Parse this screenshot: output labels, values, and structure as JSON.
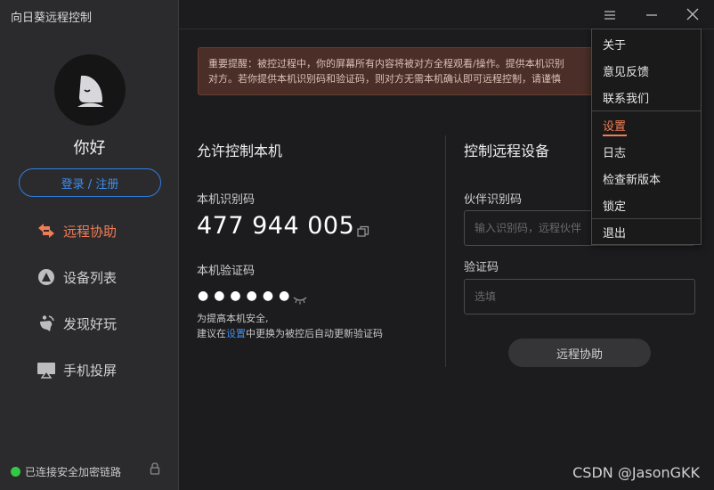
{
  "app": {
    "title": "向日葵远程控制"
  },
  "user": {
    "greeting": "你好",
    "login_label": "登录 / 注册"
  },
  "sidebar": {
    "items": [
      {
        "label": "远程协助",
        "icon": "remote-assist-icon",
        "active": true
      },
      {
        "label": "设备列表",
        "icon": "device-list-icon",
        "active": false
      },
      {
        "label": "发现好玩",
        "icon": "discover-icon",
        "active": false
      },
      {
        "label": "手机投屏",
        "icon": "screen-cast-icon",
        "active": false
      }
    ],
    "status": "已连接安全加密链路"
  },
  "notice": {
    "line1": "重要提醒：被控过程中，你的屏幕所有内容将被对方全程观看/操作。提供本机识别",
    "line2": "对方。若你提供本机识别码和验证码，则对方无需本机确认即可远程控制，请谨慎"
  },
  "local": {
    "title": "允许控制本机",
    "id_label": "本机识别码",
    "id_value": "477 944 005",
    "pwd_label": "本机验证码",
    "pwd_value": "●●●●●●",
    "hint_line1": "为提高本机安全,",
    "hint_pre": "建议在",
    "hint_link": "设置",
    "hint_post": "中更换为被控后自动更新验证码"
  },
  "remote": {
    "title": "控制远程设备",
    "partner_label": "伙伴识别码",
    "partner_placeholder": "输入识别码，远程伙伴",
    "code_label": "验证码",
    "code_placeholder": "选填",
    "connect_label": "远程协助"
  },
  "menu": {
    "items": [
      "关于",
      "意见反馈",
      "联系我们",
      "设置",
      "日志",
      "检查新版本",
      "锁定",
      "退出"
    ],
    "active": "设置"
  },
  "watermark": "CSDN @JasonGKK",
  "colors": {
    "accent": "#f07d56",
    "link": "#3d8ef0",
    "online": "#33c944",
    "notice_bg": "#4a2e27"
  }
}
